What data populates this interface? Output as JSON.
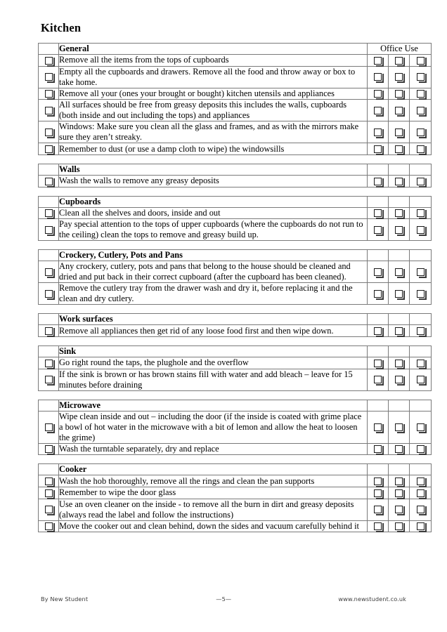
{
  "document": {
    "title": "Kitchen",
    "office_use_label": "Office Use",
    "checkbox_icon": "empty-checkbox"
  },
  "sections": [
    {
      "heading": "General",
      "has_office_use_header": true,
      "rows": [
        {
          "text": "Remove all the items from the tops of cupboards"
        },
        {
          "text": "Empty all the cupboards and drawers. Remove all the food and throw away or box to take home."
        },
        {
          "text": "Remove all your (ones your brought or bought) kitchen utensils and appliances"
        },
        {
          "text": "All surfaces should be free from greasy deposits this includes the walls, cupboards (both inside and out including the tops) and appliances"
        },
        {
          "text": "Windows: Make sure you clean all the glass and frames, and as with the mirrors make sure they aren’t streaky."
        },
        {
          "text": "Remember to dust (or use a damp cloth to wipe) the windowsills"
        }
      ]
    },
    {
      "heading": "Walls",
      "has_office_use_header": false,
      "rows": [
        {
          "text": "Wash the walls to remove any greasy deposits"
        }
      ]
    },
    {
      "heading": "Cupboards",
      "has_office_use_header": false,
      "rows": [
        {
          "text": "Clean all the shelves and doors, inside and out"
        },
        {
          "text": "Pay special attention to the tops of upper cupboards (where the cupboards do not run to the ceiling) clean the tops to remove and greasy build up."
        }
      ]
    },
    {
      "heading": "Crockery, Cutlery, Pots and Pans",
      "has_office_use_header": false,
      "rows": [
        {
          "text": "Any crockery, cutlery, pots and pans that belong to the house should be cleaned and dried and put back in their correct cupboard (after the cupboard has been cleaned)."
        },
        {
          "text": "Remove the cutlery tray from the drawer wash and dry it, before replacing it and the clean and dry cutlery."
        }
      ]
    },
    {
      "heading": "Work surfaces",
      "has_office_use_header": false,
      "rows": [
        {
          "text": "Remove all appliances then get rid of any loose food first and then wipe down."
        }
      ]
    },
    {
      "heading": "Sink",
      "has_office_use_header": false,
      "rows": [
        {
          "text": "Go right round the taps, the plughole and the overflow"
        },
        {
          "text": "If the sink is brown or has brown stains fill with water and add bleach – leave for 15 minutes before draining"
        }
      ]
    },
    {
      "heading": "Microwave",
      "has_office_use_header": false,
      "rows": [
        {
          "text": "Wipe clean inside and out – including the door (if the inside is coated with grime place a bowl of hot water in the microwave with a bit of lemon and allow the heat to loosen the grime)"
        },
        {
          "text": "Wash the turntable separately, dry and replace"
        }
      ]
    },
    {
      "heading": "Cooker",
      "has_office_use_header": false,
      "rows": [
        {
          "text": "Wash the hob thoroughly, remove all the rings and clean the pan supports"
        },
        {
          "text": "Remember to wipe the door glass"
        },
        {
          "text": "Use an oven cleaner on the inside - to remove all the burn in dirt and greasy deposits (always read the label and follow the instructions)"
        },
        {
          "text": "Move the cooker out and clean behind, down the sides and vacuum carefully behind it"
        }
      ]
    }
  ],
  "footer": {
    "left": "By New Student",
    "center": "—5—",
    "right": "www.newstudent.co.uk"
  }
}
